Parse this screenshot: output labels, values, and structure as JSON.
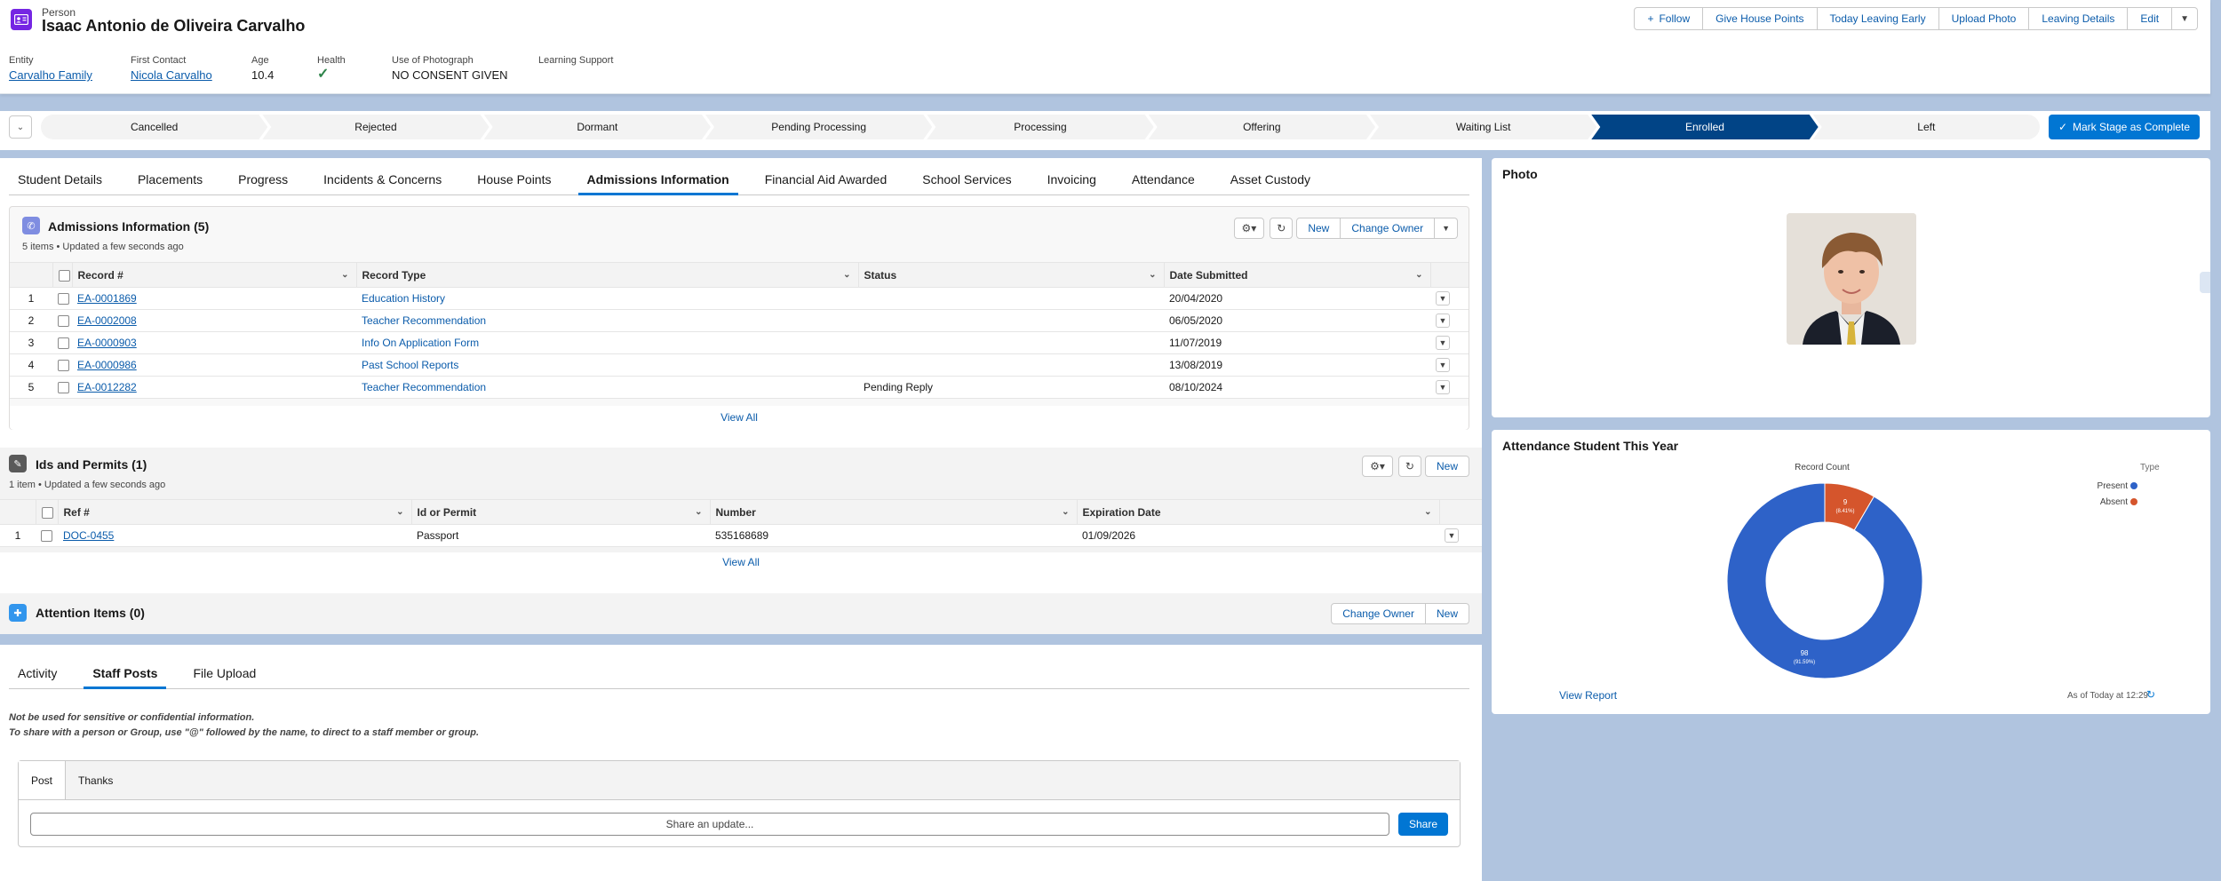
{
  "header": {
    "object_label": "Person",
    "record_name": "Isaac Antonio de Oliveira Carvalho",
    "actions": [
      "Follow",
      "Give House Points",
      "Today Leaving Early",
      "Upload Photo",
      "Leaving Details",
      "Edit"
    ],
    "fields": [
      {
        "label": "Entity",
        "value": "Carvalho Family"
      },
      {
        "label": "First Contact",
        "value": "Nicola Carvalho"
      },
      {
        "label": "Age",
        "value": "10.4"
      },
      {
        "label": "Health",
        "value": "✓"
      },
      {
        "label": "Use of Photograph",
        "value": "NO CONSENT GIVEN"
      },
      {
        "label": "Learning Support",
        "value": ""
      }
    ]
  },
  "path": {
    "stages": [
      "Cancelled",
      "Rejected",
      "Dormant",
      "Pending Processing",
      "Processing",
      "Offering",
      "Waiting List",
      "Enrolled",
      "Left"
    ],
    "active": "Enrolled",
    "mark_button": "Mark Stage as Complete"
  },
  "tabs": [
    "Student Details",
    "Placements",
    "Progress",
    "Incidents & Concerns",
    "House Points",
    "Admissions Information",
    "Financial Aid Awarded",
    "School Services",
    "Invoicing",
    "Attendance",
    "Asset Custody"
  ],
  "active_tab": "Admissions Information",
  "admissions": {
    "title": "Admissions Information (5)",
    "subtitle": "5 items • Updated a few seconds ago",
    "actions": [
      "New",
      "Change Owner"
    ],
    "columns": [
      "Record #",
      "Record Type",
      "Status",
      "Date Submitted"
    ],
    "rows": [
      {
        "n": "1",
        "record": "EA-0001869",
        "type": "Education History",
        "status": "",
        "date": "20/04/2020"
      },
      {
        "n": "2",
        "record": "EA-0002008",
        "type": "Teacher Recommendation",
        "status": "",
        "date": "06/05/2020"
      },
      {
        "n": "3",
        "record": "EA-0000903",
        "type": "Info On Application Form",
        "status": "",
        "date": "11/07/2019"
      },
      {
        "n": "4",
        "record": "EA-0000986",
        "type": "Past School Reports",
        "status": "",
        "date": "13/08/2019"
      },
      {
        "n": "5",
        "record": "EA-0012282",
        "type": "Teacher Recommendation",
        "status": "Pending Reply",
        "date": "08/10/2024"
      }
    ],
    "view_all": "View All"
  },
  "ids": {
    "title": "Ids and Permits (1)",
    "subtitle": "1 item • Updated a few seconds ago",
    "actions": [
      "New"
    ],
    "columns": [
      "Ref #",
      "Id or Permit",
      "Number",
      "Expiration Date"
    ],
    "rows": [
      {
        "n": "1",
        "ref": "DOC-0455",
        "kind": "Passport",
        "number": "535168689",
        "expiry": "01/09/2026"
      }
    ],
    "view_all": "View All"
  },
  "attention": {
    "title": "Attention Items (0)",
    "actions": [
      "Change Owner",
      "New"
    ]
  },
  "posts": {
    "tabs": [
      "Activity",
      "Staff Posts",
      "File Upload"
    ],
    "active": "Staff Posts",
    "note1": "Not be used for sensitive or confidential information.",
    "note2": "To share with a person or Group, use \"@\" followed by the name, to direct to a staff member or group.",
    "publisher_tabs": [
      "Post",
      "Thanks"
    ],
    "placeholder": "Share an update...",
    "share": "Share"
  },
  "photo_card": {
    "title": "Photo"
  },
  "attendance": {
    "title": "Attendance Student This Year",
    "view_report": "View Report",
    "timestamp": "As of Today at 12:29",
    "legend_title": "Type",
    "chart_title": "Record Count",
    "colors": {
      "Present": "#2e62c8",
      "Absent": "#d5552c"
    }
  },
  "chart_data": {
    "type": "pie",
    "title": "Record Count",
    "legend_title": "Type",
    "legend_position": "top-right",
    "categories": [
      "Present",
      "Absent"
    ],
    "values": [
      98,
      9
    ],
    "labels": [
      "98",
      "9"
    ],
    "percent_labels": [
      "(91.59%)",
      "(8.41%)"
    ]
  }
}
